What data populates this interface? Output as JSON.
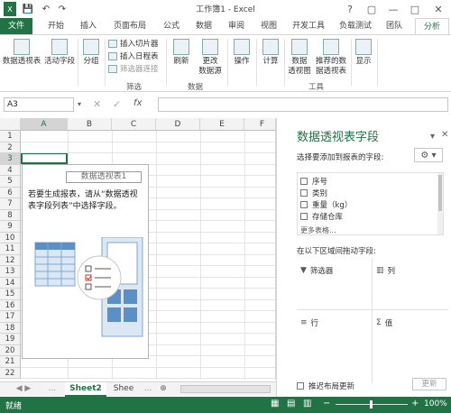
{
  "window": {
    "title": "工作簿1 - Excel",
    "help": "?",
    "restore": "▢",
    "minimize": "—",
    "maximize": "□",
    "close": "✕"
  },
  "qat": {
    "save": "💾",
    "undo": "↶",
    "redo": "↷"
  },
  "tabs": [
    "文件",
    "开始",
    "插入",
    "页面布局",
    "公式",
    "数据",
    "审阅",
    "视图",
    "开发工具",
    "负载测试",
    "团队",
    "分析"
  ],
  "ribbon": {
    "pivot_table": "数据透视表",
    "active_field": "活动字段",
    "group": "分组",
    "insert_slicer": "插入切片器",
    "insert_timeline": "插入日程表",
    "filter_connections": "筛选器连接",
    "filter_group": "筛选",
    "refresh": "刷新",
    "change_source_1": "更改",
    "change_source_2": "数据源",
    "data_group": "数据",
    "actions": "操作",
    "calculations": "计算",
    "pivot_chart_1": "数据",
    "pivot_chart_2": "透视图",
    "recommended_1": "推荐的数",
    "recommended_2": "据透视表",
    "tools_group": "工具",
    "show": "显示"
  },
  "formula_bar": {
    "namebox": "A3",
    "cancel": "✕",
    "enter": "✓",
    "fx": "fx",
    "formula": ""
  },
  "grid": {
    "columns": [
      "A",
      "B",
      "C",
      "D",
      "E",
      "F"
    ],
    "rows": [
      "1",
      "2",
      "3",
      "4",
      "5",
      "6",
      "7",
      "8",
      "9",
      "10",
      "11",
      "12",
      "13",
      "14",
      "15",
      "16",
      "17",
      "18",
      "19",
      "20",
      "21",
      "22"
    ]
  },
  "pivot_placeholder": {
    "label": "数据透视表1",
    "message": "若要生成报表，请从“数据透视表字段列表”中选择字段。"
  },
  "sheets": {
    "nav": "◀ ▶",
    "tabs": [
      "Sheet2",
      "Shee"
    ],
    "more": "...",
    "add": "⊕"
  },
  "status": {
    "ready": "就绪",
    "zoom": "100%"
  },
  "pane": {
    "title": "数据透视表字段",
    "subtitle": "选择要添加到报表的字段:",
    "fields": [
      "序号",
      "类别",
      "重量（kg）",
      "存储仓库"
    ],
    "more_tables": "更多表格...",
    "drag_tip": "在以下区域间拖动字段:",
    "filters": "筛选器",
    "columns": "列",
    "rows": "行",
    "values": "值",
    "defer": "推迟布局更新",
    "update": "更新"
  }
}
